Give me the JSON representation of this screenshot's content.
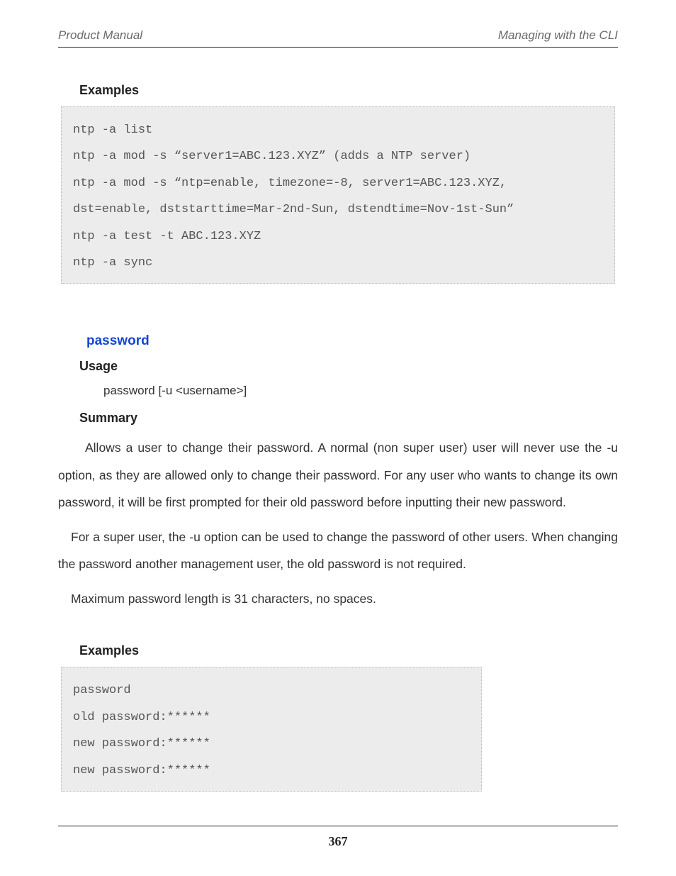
{
  "header": {
    "left": "Product Manual",
    "right": "Managing with the CLI"
  },
  "ntp_section": {
    "examples_heading": "Examples",
    "code": "ntp -a list\nntp -a mod -s “server1=ABC.123.XYZ” (adds a NTP server)\nntp -a mod -s “ntp=enable, timezone=-8, server1=ABC.123.XYZ,\ndst=enable, dststarttime=Mar-2nd-Sun, dstendtime=Nov-1st-Sun”\nntp -a test -t ABC.123.XYZ\nntp -a sync"
  },
  "password_section": {
    "command_heading": "password",
    "usage_heading": "Usage",
    "usage_line": "password [-u <username>]",
    "summary_heading": "Summary",
    "summary_p1": "Allows a user to change their password.  A normal (non super user) user will never use the -u option, as they are allowed only to change their password. For any user who wants to change its own password, it will be first prompted for their old password before inputting their new password.",
    "summary_p2": "For a super user, the -u option can be used to change the password of other users.  When changing the password another management user, the old password is not required.",
    "summary_p3": "Maximum password length is 31 characters, no spaces.",
    "examples_heading": "Examples",
    "code": "password\nold password:******\nnew password:******\nnew password:******"
  },
  "page_number": "367"
}
